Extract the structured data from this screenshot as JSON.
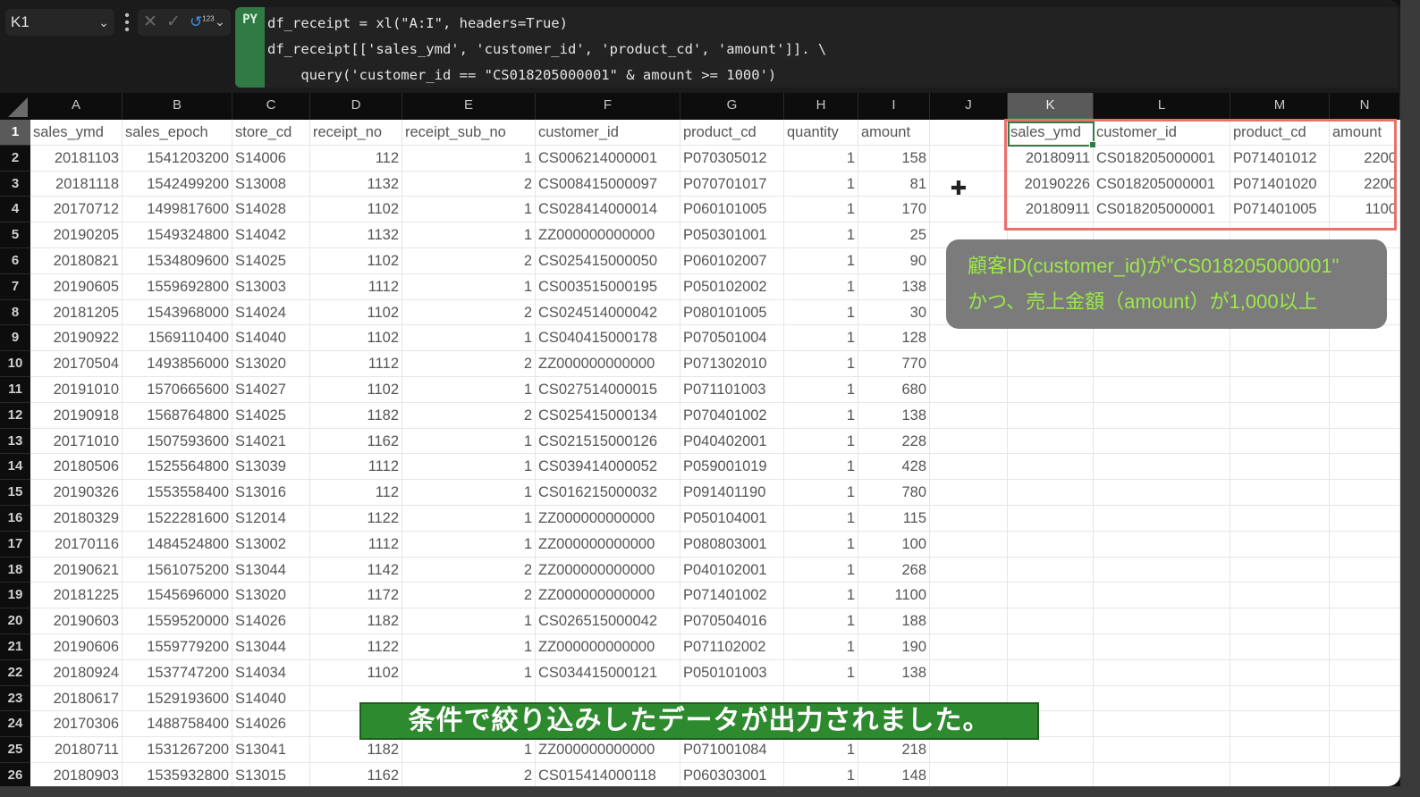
{
  "formula_bar": {
    "name_box": "K1",
    "name_box_dropdown_icon": "chevron-down-icon",
    "more_icon": "vertical-ellipsis-icon",
    "cancel_icon": "close-icon",
    "enter_icon": "checkmark-icon",
    "output_type_icon": "python-output-123-icon",
    "output_type_label": "123",
    "output_dropdown_icon": "chevron-down-icon",
    "py_tag": "PY",
    "code_lines": [
      "df_receipt = xl(\"A:I\", headers=True)",
      "df_receipt[['sales_ymd', 'customer_id', 'product_cd', 'amount']]. \\",
      "    query('customer_id == \"CS018205000001\" & amount >= 1000')"
    ]
  },
  "sheet": {
    "columns": [
      "A",
      "B",
      "C",
      "D",
      "E",
      "F",
      "G",
      "H",
      "I",
      "J",
      "K",
      "L",
      "M",
      "N"
    ],
    "selected_column": "K",
    "selected_cell": "K1",
    "row_numbers": [
      "1",
      "2",
      "3",
      "4",
      "5",
      "6",
      "7",
      "8",
      "9",
      "10",
      "11",
      "12",
      "13",
      "14",
      "15",
      "16",
      "17",
      "18",
      "19",
      "20",
      "21",
      "22",
      "23",
      "24",
      "25",
      "26"
    ],
    "source_headers": [
      "sales_ymd",
      "sales_epoch",
      "store_cd",
      "receipt_no",
      "receipt_sub_no",
      "customer_id",
      "product_cd",
      "quantity",
      "amount"
    ],
    "source_rows": [
      [
        "20181103",
        "1541203200",
        "S14006",
        "112",
        "1",
        "CS006214000001",
        "P070305012",
        "1",
        "158"
      ],
      [
        "20181118",
        "1542499200",
        "S13008",
        "1132",
        "2",
        "CS008415000097",
        "P070701017",
        "1",
        "81"
      ],
      [
        "20170712",
        "1499817600",
        "S14028",
        "1102",
        "1",
        "CS028414000014",
        "P060101005",
        "1",
        "170"
      ],
      [
        "20190205",
        "1549324800",
        "S14042",
        "1132",
        "1",
        "ZZ000000000000",
        "P050301001",
        "1",
        "25"
      ],
      [
        "20180821",
        "1534809600",
        "S14025",
        "1102",
        "2",
        "CS025415000050",
        "P060102007",
        "1",
        "90"
      ],
      [
        "20190605",
        "1559692800",
        "S13003",
        "1112",
        "1",
        "CS003515000195",
        "P050102002",
        "1",
        "138"
      ],
      [
        "20181205",
        "1543968000",
        "S14024",
        "1102",
        "2",
        "CS024514000042",
        "P080101005",
        "1",
        "30"
      ],
      [
        "20190922",
        "1569110400",
        "S14040",
        "1102",
        "1",
        "CS040415000178",
        "P070501004",
        "1",
        "128"
      ],
      [
        "20170504",
        "1493856000",
        "S13020",
        "1112",
        "2",
        "ZZ000000000000",
        "P071302010",
        "1",
        "770"
      ],
      [
        "20191010",
        "1570665600",
        "S14027",
        "1102",
        "1",
        "CS027514000015",
        "P071101003",
        "1",
        "680"
      ],
      [
        "20190918",
        "1568764800",
        "S14025",
        "1182",
        "2",
        "CS025415000134",
        "P070401002",
        "1",
        "138"
      ],
      [
        "20171010",
        "1507593600",
        "S14021",
        "1162",
        "1",
        "CS021515000126",
        "P040402001",
        "1",
        "228"
      ],
      [
        "20180506",
        "1525564800",
        "S13039",
        "1112",
        "1",
        "CS039414000052",
        "P059001019",
        "1",
        "428"
      ],
      [
        "20190326",
        "1553558400",
        "S13016",
        "112",
        "1",
        "CS016215000032",
        "P091401190",
        "1",
        "780"
      ],
      [
        "20180329",
        "1522281600",
        "S12014",
        "1122",
        "1",
        "ZZ000000000000",
        "P050104001",
        "1",
        "115"
      ],
      [
        "20170116",
        "1484524800",
        "S13002",
        "1112",
        "1",
        "ZZ000000000000",
        "P080803001",
        "1",
        "100"
      ],
      [
        "20190621",
        "1561075200",
        "S13044",
        "1142",
        "2",
        "ZZ000000000000",
        "P040102001",
        "1",
        "268"
      ],
      [
        "20181225",
        "1545696000",
        "S13020",
        "1172",
        "2",
        "ZZ000000000000",
        "P071401002",
        "1",
        "1100"
      ],
      [
        "20190603",
        "1559520000",
        "S14026",
        "1182",
        "1",
        "CS026515000042",
        "P070504016",
        "1",
        "188"
      ],
      [
        "20190606",
        "1559779200",
        "S13044",
        "1122",
        "1",
        "ZZ000000000000",
        "P071102002",
        "1",
        "190"
      ],
      [
        "20180924",
        "1537747200",
        "S14034",
        "1102",
        "1",
        "CS034415000121",
        "P050101003",
        "1",
        "138"
      ],
      [
        "20180617",
        "1529193600",
        "S14040",
        "",
        "",
        "",
        "",
        "",
        ""
      ],
      [
        "20170306",
        "1488758400",
        "S14026",
        "",
        "",
        "",
        "",
        "",
        ""
      ],
      [
        "20180711",
        "1531267200",
        "S13041",
        "1182",
        "1",
        "ZZ000000000000",
        "P071001084",
        "1",
        "218"
      ],
      [
        "20180903",
        "1535932800",
        "S13015",
        "1162",
        "2",
        "CS015414000118",
        "P060303001",
        "1",
        "148"
      ]
    ],
    "result_headers": [
      "sales_ymd",
      "customer_id",
      "product_cd",
      "amount"
    ],
    "result_rows": [
      [
        "20180911",
        "CS018205000001",
        "P071401012",
        "2200"
      ],
      [
        "20190226",
        "CS018205000001",
        "P071401020",
        "2200"
      ],
      [
        "20180911",
        "CS018205000001",
        "P071401005",
        "1100"
      ]
    ]
  },
  "annotation": {
    "line1": "顧客ID(customer_id)が\"CS018205000001\"",
    "line2": "かつ、売上金額（amount）が1,000以上"
  },
  "caption": "条件で絞り込みしたデータが出力されました。",
  "cursor_icon": "move-cursor-icon",
  "colors": {
    "python_green": "#2f7a45",
    "highlight_red": "#e8726b",
    "annotation_text": "#9be84a",
    "caption_bg": "#2e8a2e"
  }
}
